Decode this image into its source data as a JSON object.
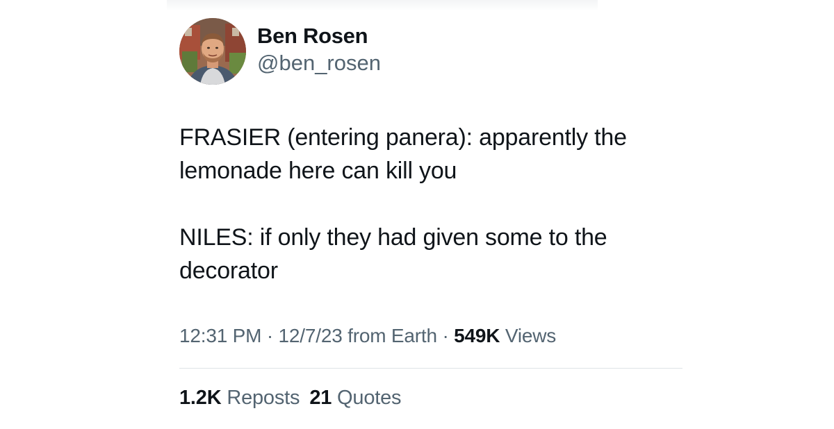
{
  "tweet": {
    "author": {
      "display_name": "Ben Rosen",
      "handle": "@ben_rosen"
    },
    "paragraphs": [
      "FRASIER (entering panera): apparently the\nlemonade here can kill you",
      "NILES: if only they had given some to the\ndecorator"
    ],
    "meta": {
      "time": "12:31 PM",
      "separator": " · ",
      "date": "12/7/23",
      "source": " from Earth",
      "views_count": "549K",
      "views_label": " Views"
    },
    "stats": {
      "reposts_count": "1.2K",
      "reposts_label": " Reposts",
      "quotes_count": "21",
      "quotes_label": " Quotes"
    }
  },
  "colors": {
    "text_primary": "#0f1419",
    "text_secondary": "#536471",
    "divider": "#dfe3e6",
    "background": "#ffffff"
  }
}
